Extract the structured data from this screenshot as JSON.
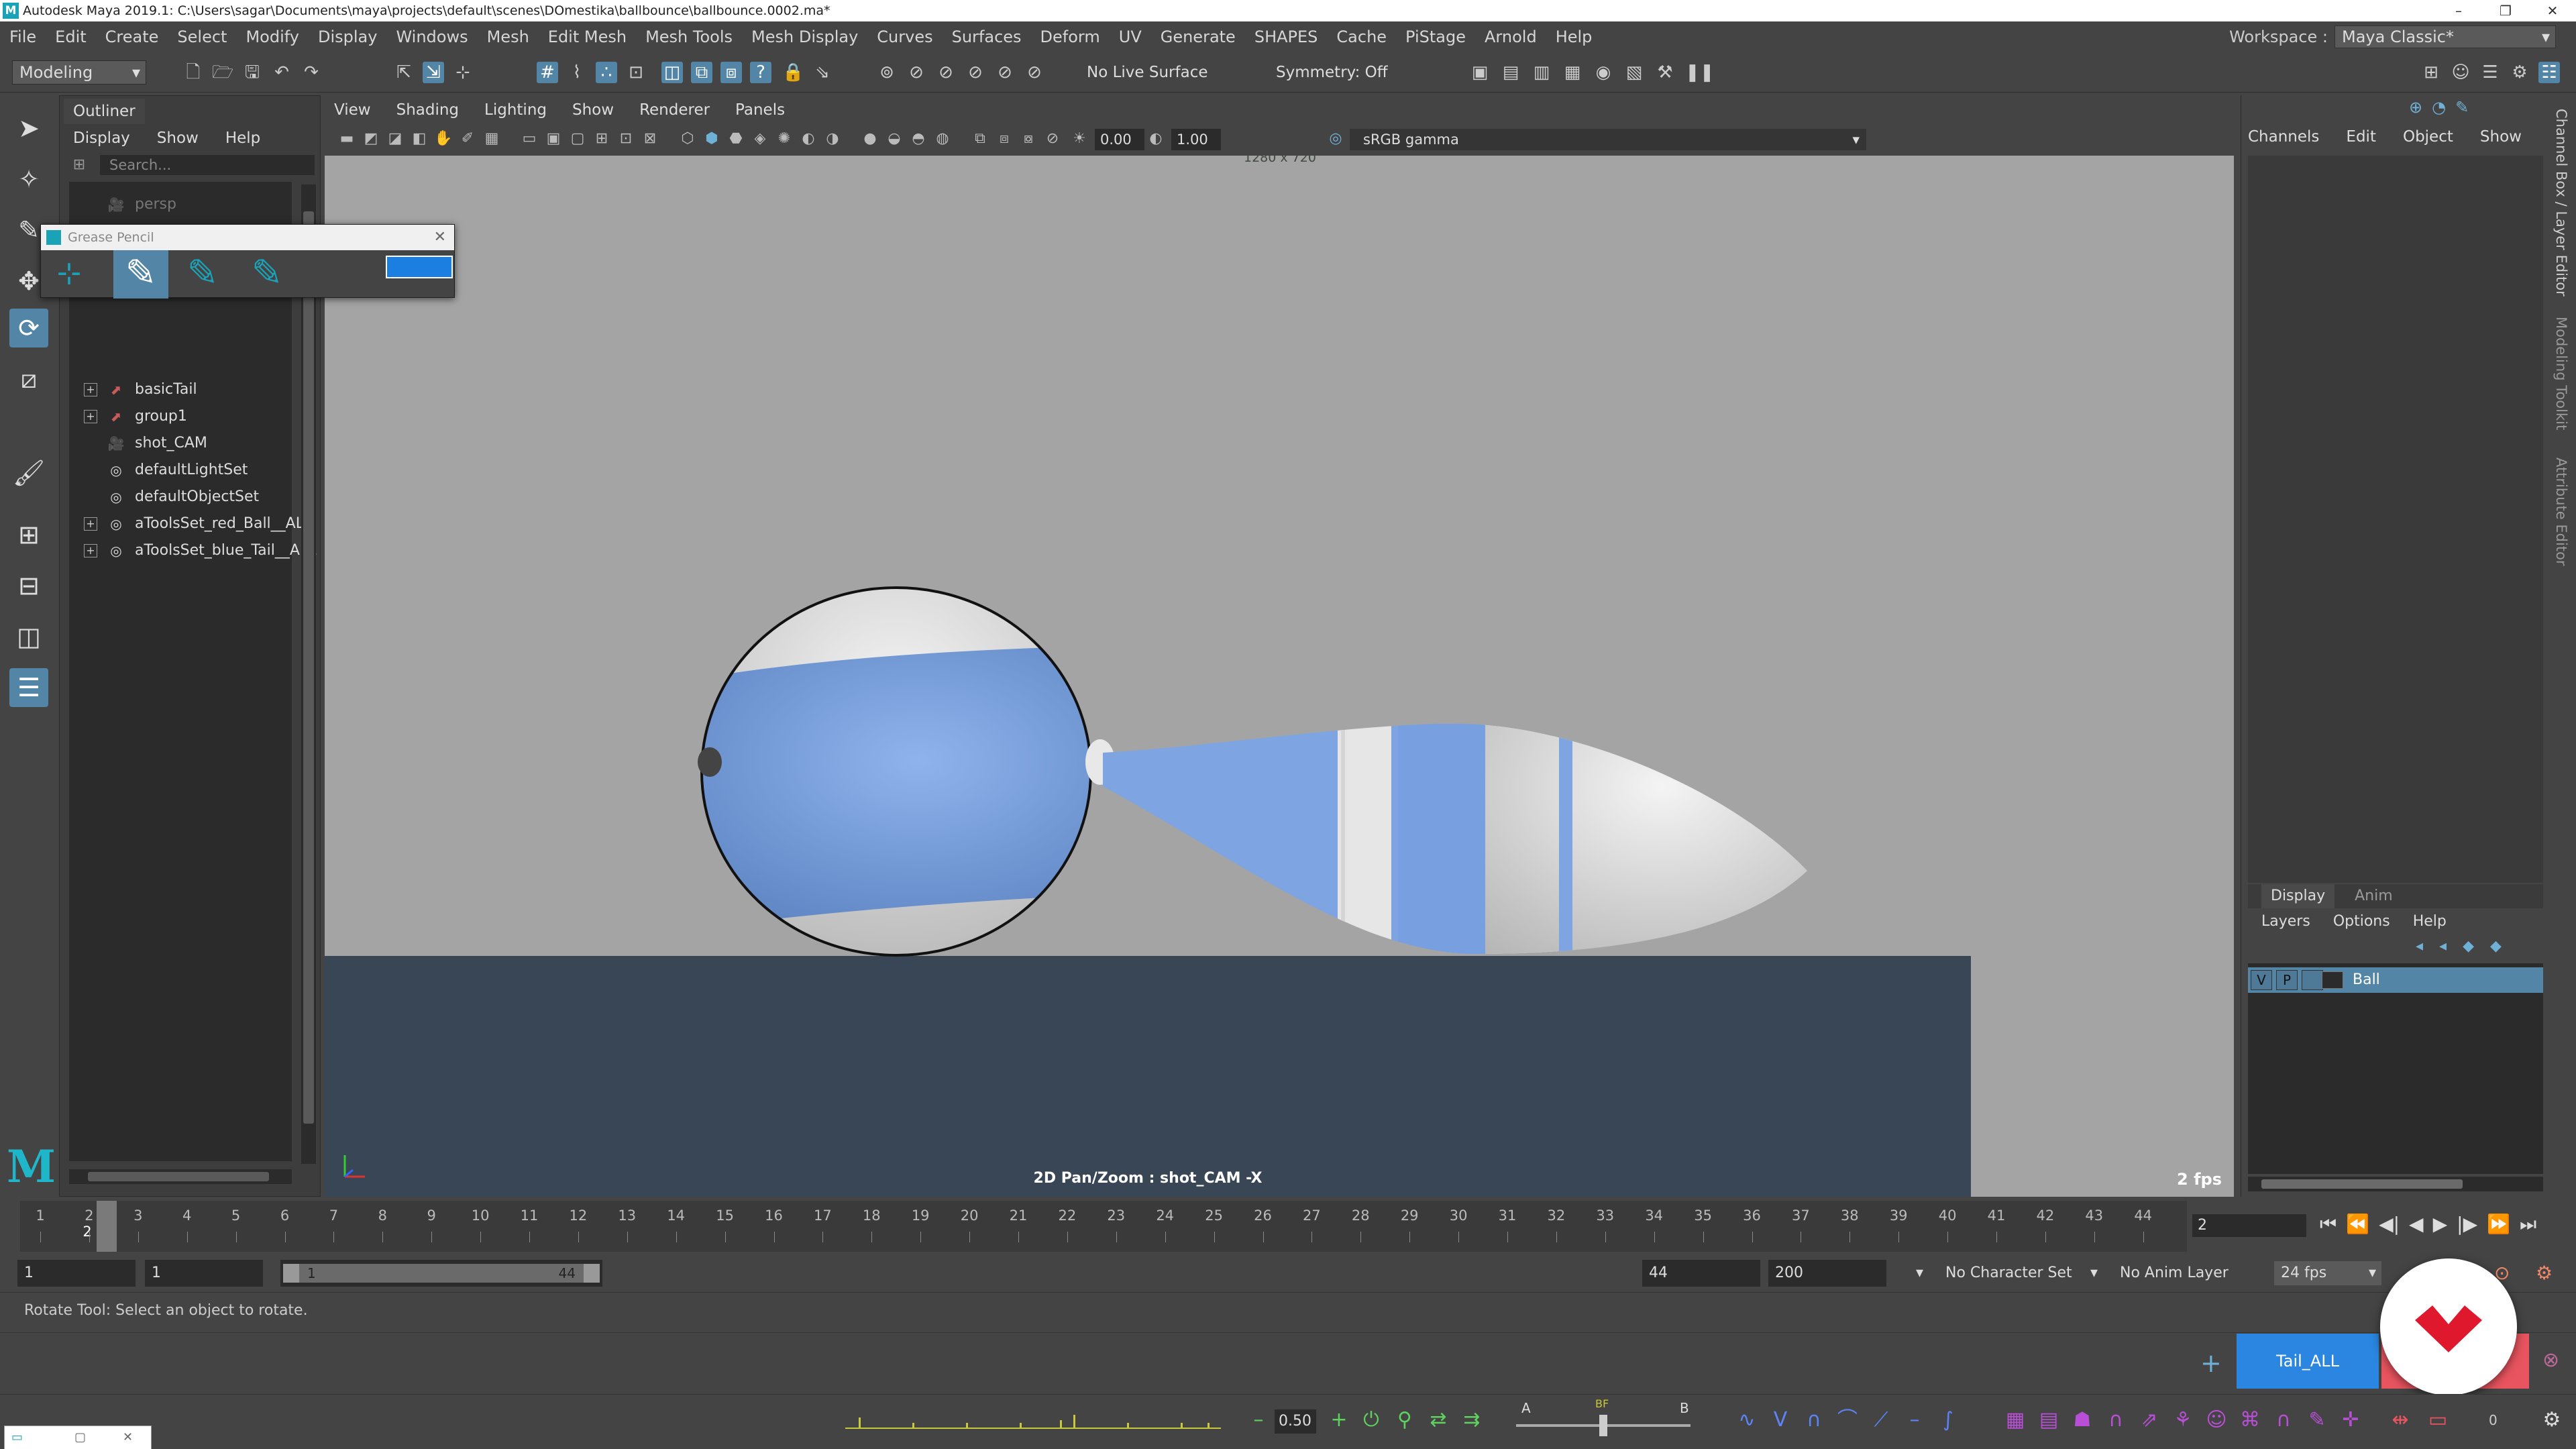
{
  "title_bar": {
    "title": "Autodesk Maya 2019.1: C:\\Users\\sagar\\Documents\\maya\\projects\\default\\scenes\\DOmestika\\ballbounce\\ballbounce.0002.ma*",
    "logo": "M"
  },
  "menubar": {
    "items": [
      "File",
      "Edit",
      "Create",
      "Select",
      "Modify",
      "Display",
      "Windows",
      "Mesh",
      "Edit Mesh",
      "Mesh Tools",
      "Mesh Display",
      "Curves",
      "Surfaces",
      "Deform",
      "UV",
      "Generate",
      "SHAPES",
      "Cache",
      "PiStage",
      "Arnold",
      "Help"
    ],
    "workspace_label": "Workspace :",
    "workspace_value": "Maya Classic*"
  },
  "shelf": {
    "mode": "Modeling",
    "live_surface": "No Live Surface",
    "symmetry": "Symmetry: Off"
  },
  "outliner": {
    "tab": "Outliner",
    "menu": [
      "Display",
      "Show",
      "Help"
    ],
    "search_placeholder": "Search...",
    "items": [
      {
        "label": "persp",
        "icon": "camera-icon",
        "expand": false
      },
      {
        "label": "basicTail",
        "icon": "transform-icon",
        "expand": true
      },
      {
        "label": "group1",
        "icon": "transform-icon",
        "expand": true
      },
      {
        "label": "shot_CAM",
        "icon": "camera-icon",
        "expand": false
      },
      {
        "label": "defaultLightSet",
        "icon": "set-icon",
        "expand": false
      },
      {
        "label": "defaultObjectSet",
        "icon": "set-icon",
        "expand": false
      },
      {
        "label": "aToolsSet_red_Ball__ALL",
        "icon": "set-icon",
        "expand": true
      },
      {
        "label": "aToolsSet_blue_Tail__ALL",
        "icon": "set-icon",
        "expand": true
      }
    ]
  },
  "grease_pencil": {
    "title": "Grease Pencil",
    "close": "✕",
    "color": "#1a7fe0"
  },
  "viewport": {
    "menu": [
      "View",
      "Shading",
      "Lighting",
      "Show",
      "Renderer",
      "Panels"
    ],
    "exposure": "0.00",
    "gamma": "1.00",
    "color_space": "sRGB gamma",
    "resolution": "1280 x 720",
    "status": "2D Pan/Zoom : shot_CAM -X",
    "fps": "2 fps"
  },
  "channel_box": {
    "menu": [
      "Channels",
      "Edit",
      "Object",
      "Show"
    ],
    "layer_tabs": [
      "Display",
      "Anim"
    ],
    "layer_menu": [
      "Layers",
      "Options",
      "Help"
    ],
    "layer": {
      "v": "V",
      "p": "P",
      "name": "Ball"
    }
  },
  "side_tabs": [
    "Channel Box / Layer Editor",
    "Modeling Toolkit",
    "Attribute Editor"
  ],
  "timeline": {
    "ticks": [
      1,
      2,
      3,
      4,
      5,
      6,
      7,
      8,
      9,
      10,
      11,
      12,
      13,
      14,
      15,
      16,
      17,
      18,
      19,
      20,
      21,
      22,
      23,
      24,
      25,
      26,
      27,
      28,
      29,
      30,
      31,
      32,
      33,
      34,
      35,
      36,
      37,
      38,
      39,
      40,
      41,
      42,
      43,
      44
    ],
    "current_frame_label": "2",
    "current_frame_field": "2"
  },
  "range": {
    "start": "1",
    "playback_start": "1",
    "slider_start": "1",
    "slider_end": "44",
    "playback_end": "44",
    "end": "200",
    "character_set": "No Character Set",
    "anim_layer": "No Anim Layer",
    "fps": "24 fps"
  },
  "help_line": "Rotate Tool: Select an object to rotate.",
  "command": {
    "selection_set": "Tail_ALL"
  },
  "bottom": {
    "field": "0.50",
    "a_label": "A",
    "b_label": "B",
    "bf_label": "BF",
    "right_value": "0"
  },
  "colors": {
    "accent": "#5285a6",
    "ball_blue": "#6e97d8",
    "ground": "#394656",
    "viewport_bg": "#a4a4a4",
    "logo_red": "#e8545f"
  }
}
